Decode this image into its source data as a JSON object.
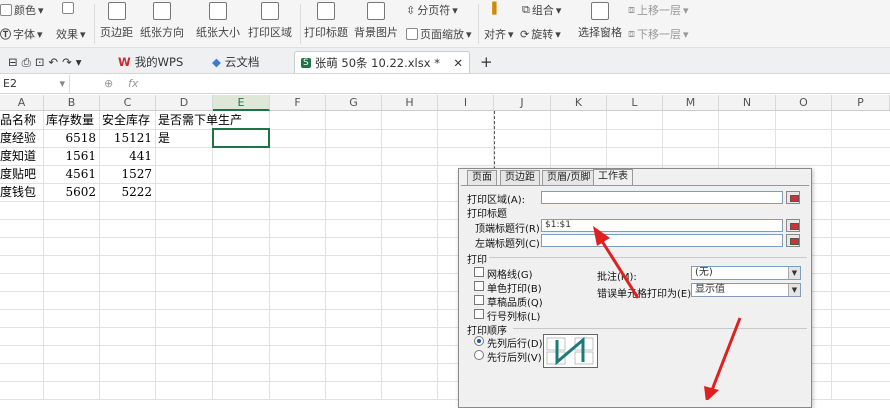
{
  "ribbon": {
    "row1": {
      "color": "颜色",
      "page_break": "分页符",
      "combine": "组合",
      "up_layer": "上移一层"
    },
    "row2": {
      "font": "字体",
      "effect": "效果",
      "align": "对齐",
      "rotate": "旋转",
      "down_layer": "下移一层"
    },
    "big": {
      "margins": "页边距",
      "orientation": "纸张方向",
      "size": "纸张大小",
      "print_area": "打印区域",
      "print_titles": "打印标题",
      "background": "背景图片",
      "page_zoom": "页面缩放",
      "select_pane": "选择窗格"
    }
  },
  "tabs": [
    {
      "label": "我的WPS"
    },
    {
      "label": "云文档"
    },
    {
      "label": "张萌  50条 10.22.xlsx *"
    }
  ],
  "formula": {
    "cell_ref": "E2",
    "fx": "fx"
  },
  "columns": [
    "A",
    "B",
    "C",
    "D",
    "E",
    "F",
    "G",
    "H",
    "I",
    "J",
    "K",
    "L",
    "M",
    "N",
    "O",
    "P"
  ],
  "rows": [
    [
      "产品名称",
      "库存数量",
      "安全库存",
      "是否需下单生产"
    ],
    [
      "百度经验",
      "6518",
      "15121",
      "是"
    ],
    [
      "百度知道",
      "1561",
      "441",
      ""
    ],
    [
      "百度贴吧",
      "4561",
      "1527",
      ""
    ],
    [
      "百度钱包",
      "5602",
      "5222",
      ""
    ]
  ],
  "dialog": {
    "tabs": [
      "页面",
      "页边距",
      "页眉/页脚",
      "工作表"
    ],
    "print_area_label": "打印区域(A):",
    "print_titles_label": "打印标题",
    "top_rows_label": "顶端标题行(R):",
    "top_rows_value": "$1:$1",
    "left_cols_label": "左端标题列(C):",
    "print_label": "打印",
    "gridlines": "网格线(G)",
    "single_color": "单色打印(B)",
    "draft": "草稿品质(Q)",
    "row_col_headers": "行号列标(L)",
    "comments_label": "批注(M):",
    "comments_value": "(无)",
    "errors_label": "错误单元格打印为(E):",
    "errors_value": "显示值",
    "order_label": "打印顺序",
    "down_then_over": "先列后行(D)",
    "over_then_down": "先行后列(V)"
  },
  "colors": {
    "accent": "#217346",
    "arrow": "#e02020"
  }
}
